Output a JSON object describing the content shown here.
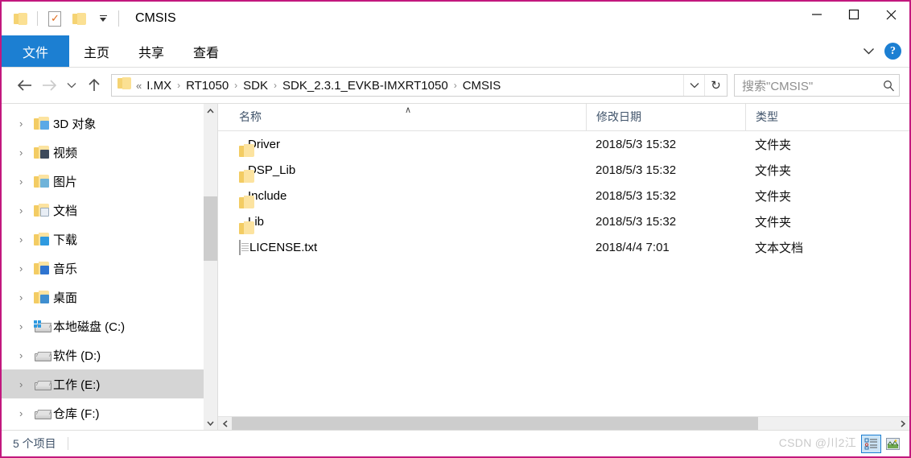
{
  "window": {
    "title": "CMSIS",
    "border_color": "#c2187e",
    "quick_access": [
      {
        "name": "folder-icon",
        "label": "文件夹"
      },
      {
        "name": "properties-icon",
        "label": "属性"
      },
      {
        "name": "new-folder-icon",
        "label": "新建文件夹"
      },
      {
        "name": "customize-dropdown-icon",
        "label": "自定义快速访问工具栏"
      }
    ],
    "controls": {
      "minimize": "最小化",
      "maximize": "最大化",
      "close": "关闭"
    }
  },
  "ribbon": {
    "tabs": [
      {
        "label": "文件",
        "active": true
      },
      {
        "label": "主页",
        "active": false
      },
      {
        "label": "共享",
        "active": false
      },
      {
        "label": "查看",
        "active": false
      }
    ],
    "accent_color": "#1c7fd2",
    "expand_label": "展开功能区",
    "help_label": "?"
  },
  "address": {
    "back_label": "后退",
    "forward_label": "前进",
    "recent_label": "最近浏览的位置",
    "up_label": "上移",
    "overflow": "«",
    "crumbs": [
      "I.MX",
      "RT1050",
      "SDK",
      "SDK_2.3.1_EVKB-IMXRT1050",
      "CMSIS"
    ],
    "separator": "›",
    "dropdown_label": "先前的位置",
    "refresh_label": "刷新"
  },
  "search": {
    "placeholder": "搜索\"CMSIS\"",
    "value": "",
    "icon": "search-icon"
  },
  "sidebar": {
    "items": [
      {
        "label": "3D 对象",
        "icon": "folder-3d-objects-icon",
        "badge": "#5aa9e6",
        "type": "folder",
        "selected": false
      },
      {
        "label": "视频",
        "icon": "folder-videos-icon",
        "badge": "#3d4a5c",
        "type": "folder",
        "selected": false
      },
      {
        "label": "图片",
        "icon": "folder-pictures-icon",
        "badge": "#6fb3d9",
        "type": "folder",
        "selected": false
      },
      {
        "label": "文档",
        "icon": "folder-documents-icon",
        "badge": "#e8eef5",
        "type": "folder",
        "selected": false
      },
      {
        "label": "下载",
        "icon": "folder-downloads-icon",
        "badge": "#2f9ae0",
        "type": "folder",
        "selected": false
      },
      {
        "label": "音乐",
        "icon": "folder-music-icon",
        "badge": "#2f74d0",
        "type": "folder",
        "selected": false
      },
      {
        "label": "桌面",
        "icon": "folder-desktop-icon",
        "badge": "#3f8fd0",
        "type": "folder",
        "selected": false
      },
      {
        "label": "本地磁盘 (C:)",
        "icon": "drive-system-icon",
        "type": "drive-system",
        "selected": false
      },
      {
        "label": "软件 (D:)",
        "icon": "drive-icon",
        "type": "drive",
        "selected": false
      },
      {
        "label": "工作 (E:)",
        "icon": "drive-icon",
        "type": "drive",
        "selected": true
      },
      {
        "label": "仓库 (F:)",
        "icon": "drive-icon",
        "type": "drive",
        "selected": false
      }
    ],
    "expander": "›",
    "scroll_up": "∧",
    "scroll_down": "∨"
  },
  "filelist": {
    "columns": [
      {
        "label": "名称",
        "sorted": "asc"
      },
      {
        "label": "修改日期",
        "sorted": ""
      },
      {
        "label": "类型",
        "sorted": ""
      }
    ],
    "sort_indicator": "∧",
    "rows": [
      {
        "name": "Driver",
        "date": "2018/5/3 15:32",
        "type": "文件夹",
        "icon": "folder-icon"
      },
      {
        "name": "DSP_Lib",
        "date": "2018/5/3 15:32",
        "type": "文件夹",
        "icon": "folder-icon"
      },
      {
        "name": "Include",
        "date": "2018/5/3 15:32",
        "type": "文件夹",
        "icon": "folder-icon"
      },
      {
        "name": "Lib",
        "date": "2018/5/3 15:32",
        "type": "文件夹",
        "icon": "folder-icon"
      },
      {
        "name": "LICENSE.txt",
        "date": "2018/4/4 7:01",
        "type": "文本文档",
        "icon": "text-file-icon"
      }
    ],
    "scroll_left": "‹",
    "scroll_right": "›"
  },
  "status": {
    "item_count": "5 个项目",
    "watermark": "CSDN @川2江",
    "views": [
      {
        "name": "details-view-button",
        "label": "详细信息",
        "active": true
      },
      {
        "name": "large-icons-view-button",
        "label": "大图标",
        "active": false
      }
    ]
  }
}
